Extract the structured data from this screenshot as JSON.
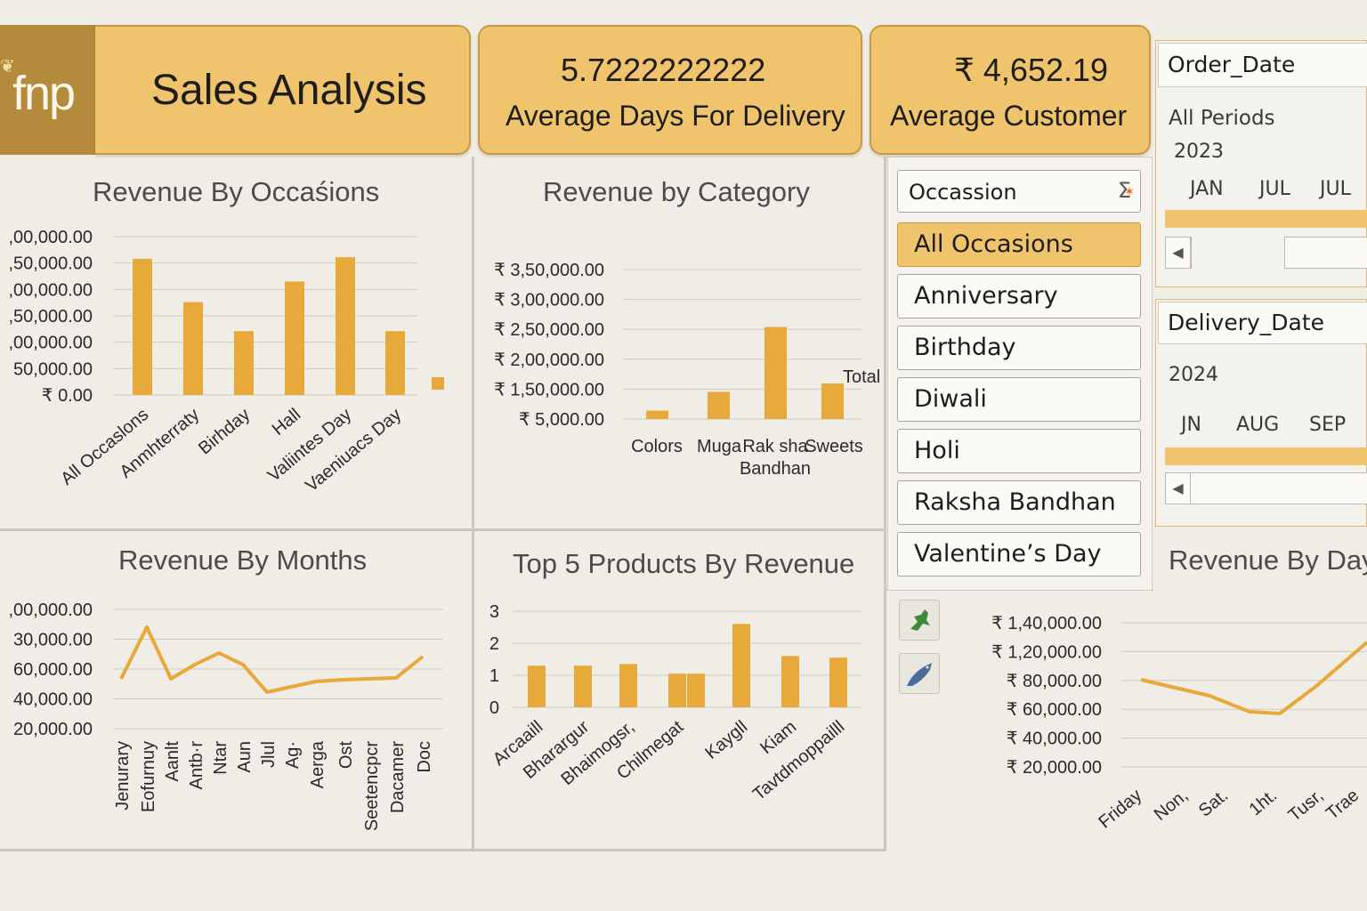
{
  "header": {
    "logo_text": "fnp",
    "title": "Sales Analysis",
    "kpi_days": {
      "value": "5.7222222222",
      "label": "Average Days For Delivery"
    },
    "kpi_customer": {
      "value": "₹ 4,652.19",
      "label": "Average Customer"
    }
  },
  "colors": {
    "accent": "#f0c46c",
    "bar": "#e6a93a",
    "line": "#e6a93a",
    "background": "#efede6"
  },
  "slicer": {
    "title": "Occassion",
    "icon": "sigma-icon",
    "items": [
      {
        "label": "All Occasions",
        "selected": true
      },
      {
        "label": "Anniversary",
        "selected": false
      },
      {
        "label": "Birthday",
        "selected": false
      },
      {
        "label": "Diwali",
        "selected": false
      },
      {
        "label": "Holi",
        "selected": false
      },
      {
        "label": "Raksha Bandhan",
        "selected": false
      },
      {
        "label": "Valentine’s Day",
        "selected": false
      }
    ]
  },
  "order_date": {
    "title": "Order_Date",
    "period": "All Periods",
    "year": "2023",
    "months": [
      "JAN",
      "JUL",
      "JUL"
    ]
  },
  "delivery_date": {
    "title": "Delivery_Date",
    "year": "2024",
    "months": [
      "JN",
      "AUG",
      "SEP"
    ]
  },
  "tools": [
    {
      "name": "pin-icon"
    },
    {
      "name": "fish-icon"
    }
  ],
  "chart_data": [
    {
      "id": "occasions",
      "type": "bar",
      "title": "Revenue By Occaśions",
      "y_ticks": [
        ",00,000.00",
        ",50,000.00",
        ",00,000.00",
        ",50,000.00",
        ",00,000.00",
        "50,000.00",
        "₹ 0.00"
      ],
      "categories": [
        "All Occaslons",
        "Anmhterraty",
        "Birhday",
        "Hall",
        "Valiintes Day",
        "Vaeniuacs Day",
        ""
      ],
      "values": [
        258000,
        176000,
        121000,
        215000,
        261000,
        121000,
        25000
      ],
      "ylim": [
        0,
        300000
      ]
    },
    {
      "id": "category",
      "type": "bar",
      "title": "Revenue by Category",
      "y_ticks": [
        "₹ 3,50,000.00",
        "₹ 3,00,000.00",
        "₹ 2,50,000.00",
        "₹ 2,00,000.00",
        "₹ 1,50,000.00",
        "₹ 5,000.00"
      ],
      "categories": [
        "Colors",
        "Muga",
        "Rak sha Bandhan",
        "Sweets"
      ],
      "values": [
        20000,
        65000,
        220000,
        85000
      ],
      "annotation": "Total",
      "ylim": [
        0,
        375000
      ]
    },
    {
      "id": "months",
      "type": "line",
      "title": "Revenue By Months",
      "y_ticks": [
        ",00,000.00",
        "30,000.00",
        "60,000.00",
        "40,000.00",
        "20,000.00"
      ],
      "categories": [
        "Jenurary",
        "Eofurnuy",
        "Aanlt",
        "Antb·r",
        "Ntar",
        "Aun",
        "Jlul",
        "Ag·",
        "Aerga",
        "Ost",
        "Seetencpcr",
        "Dacamer",
        "Doc"
      ],
      "values": [
        54000,
        68000,
        55000,
        57000,
        61000,
        57000,
        51000,
        52000,
        54000,
        55000,
        55000,
        55000,
        60000
      ]
    },
    {
      "id": "products",
      "type": "bar",
      "title": "Top 5 Products By Revenue",
      "y_ticks": [
        "3",
        "2",
        "1",
        "0"
      ],
      "categories": [
        "Arcaaill",
        "Bharargur",
        "Bhaimogsr,",
        "Chilmegat",
        "",
        "Kaygll",
        "Kiam",
        "Tavtdmoppailll"
      ],
      "values": [
        1.3,
        1.3,
        1.35,
        1.05,
        1.05,
        2.6,
        1.6,
        1.55
      ],
      "ylim": [
        0,
        3
      ]
    },
    {
      "id": "days",
      "type": "line",
      "title": "Revenue By Day",
      "y_ticks": [
        "₹ 1,40,000.00",
        "₹ 1,20,000.00",
        "₹ 80,000.00",
        "₹ 60,000.00",
        "₹ 40,000.00",
        "₹ 20,000.00"
      ],
      "categories": [
        "Friday",
        "Non,",
        "Sat.",
        "1ht.",
        "Tusr,",
        "Trae"
      ],
      "values": [
        80000,
        70000,
        57000,
        56000,
        75000,
        115000
      ]
    }
  ]
}
